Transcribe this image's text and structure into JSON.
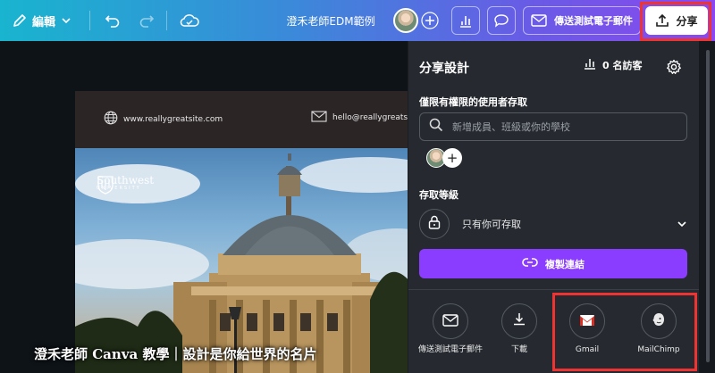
{
  "toolbar": {
    "edit_label": "編輯",
    "document_title": "澄禾老師EDM範例",
    "send_test_email_label": "傳送測試電子郵件",
    "share_label": "分享",
    "icons": [
      "pencil-icon",
      "chevron-down-icon",
      "undo-icon",
      "redo-icon",
      "cloud-save-icon",
      "plus-icon",
      "insights-icon",
      "comment-icon",
      "mail-icon",
      "upload-icon"
    ]
  },
  "design": {
    "website": "www.reallygreatsite.com",
    "email": "hello@reallygreatsite.com",
    "logo_name": "Southwest",
    "logo_sub": "UNIVERSITY",
    "watermark": "澄禾老師 Canva 教學｜設計是你給世界的名片"
  },
  "share_panel": {
    "title": "分享設計",
    "visitors": "0 名訪客",
    "people_with_access_label": "僅限有權限的使用者存取",
    "search_placeholder": "新增成員、班級或你的學校",
    "access_level_label": "存取等級",
    "access_level_value": "只有你可存取",
    "copy_link_label": "複製連結",
    "options": [
      {
        "label": "傳送測試電子郵件",
        "icon": "mail-icon"
      },
      {
        "label": "下載",
        "icon": "download-icon"
      },
      {
        "label": "Gmail",
        "icon": "gmail-icon"
      },
      {
        "label": "MailChimp",
        "icon": "mailchimp-icon"
      }
    ]
  },
  "colors": {
    "accent_purple": "#8b3dff",
    "highlight_red": "#e33333",
    "panel_bg": "#262a30",
    "gmail_red": "#d93025"
  }
}
